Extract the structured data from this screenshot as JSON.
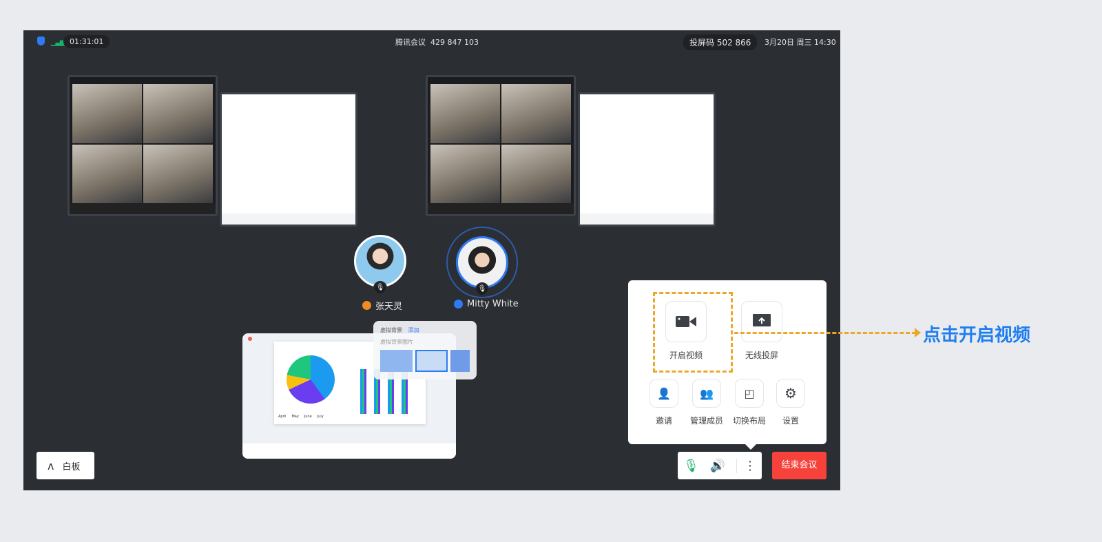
{
  "topbar": {
    "duration": "01:31:01",
    "meeting": "腾讯会议  429 847 103",
    "cast_code": "投屏码 502 866",
    "datetime": "3月20日 周三 14:30"
  },
  "participants": [
    {
      "name": "张天灵",
      "accent": "#f08a24"
    },
    {
      "name": "Mitty White",
      "accent": "#2f7bf5"
    }
  ],
  "preview": {
    "vb_title": "虚拟背景",
    "vb_add": "添加",
    "vb_subtitle": "虚拟背景图片",
    "legend": [
      "April",
      "May",
      "June",
      "July"
    ]
  },
  "panel": {
    "items": [
      {
        "label": "开启视频",
        "icon": "video-camera-icon"
      },
      {
        "label": "无线投屏",
        "icon": "screen-cast-icon"
      },
      {
        "label": "邀请",
        "icon": "invite-user-icon"
      },
      {
        "label": "管理成员",
        "icon": "members-icon"
      },
      {
        "label": "切换布局",
        "icon": "layout-switch-icon"
      },
      {
        "label": "设置",
        "icon": "gear-icon"
      }
    ]
  },
  "toolbar": {
    "whiteboard": "白板",
    "end": "结束会议"
  },
  "annotation": {
    "text": "点击开启视频",
    "color": "#1e7ef0",
    "dash_color": "#eda728"
  },
  "colors": {
    "end": "#f6423a",
    "mic": "#19b26b"
  }
}
